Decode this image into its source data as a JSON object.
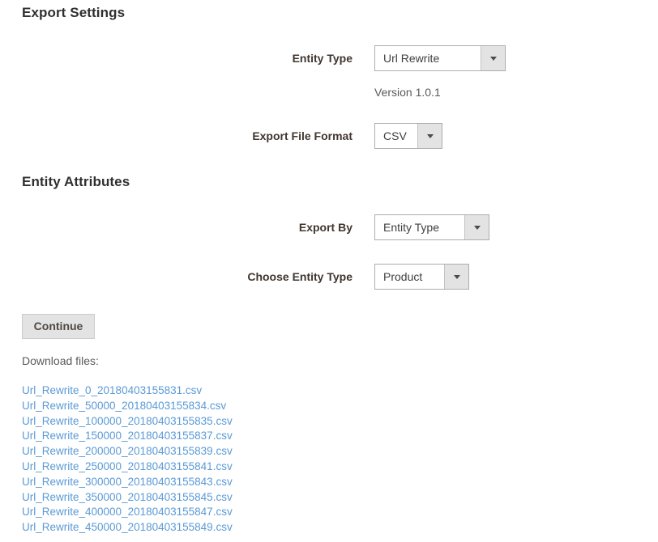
{
  "sections": {
    "export_settings": {
      "heading": "Export Settings",
      "fields": [
        {
          "label": "Entity Type",
          "value": "Url Rewrite",
          "icon": "chevron-down-icon"
        },
        {
          "label": "Export File Format",
          "value": "CSV",
          "icon": "chevron-down-icon"
        }
      ],
      "version_note": "Version 1.0.1"
    },
    "entity_attributes": {
      "heading": "Entity Attributes",
      "fields": [
        {
          "label": "Export By",
          "value": "Entity Type",
          "icon": "chevron-down-icon"
        },
        {
          "label": "Choose Entity Type",
          "value": "Product",
          "icon": "chevron-down-icon"
        }
      ]
    }
  },
  "actions": {
    "continue_label": "Continue"
  },
  "downloads": {
    "label": "Download files:",
    "files": [
      "Url_Rewrite_0_20180403155831.csv",
      "Url_Rewrite_50000_20180403155834.csv",
      "Url_Rewrite_100000_20180403155835.csv",
      "Url_Rewrite_150000_20180403155837.csv",
      "Url_Rewrite_200000_20180403155839.csv",
      "Url_Rewrite_250000_20180403155841.csv",
      "Url_Rewrite_300000_20180403155843.csv",
      "Url_Rewrite_350000_20180403155845.csv",
      "Url_Rewrite_400000_20180403155847.csv",
      "Url_Rewrite_450000_20180403155849.csv"
    ]
  },
  "colors": {
    "heading": "#303030",
    "label": "#41362f",
    "link": "#5b9ad5",
    "button_face": "#e3e3e3",
    "border": "#adadad"
  }
}
